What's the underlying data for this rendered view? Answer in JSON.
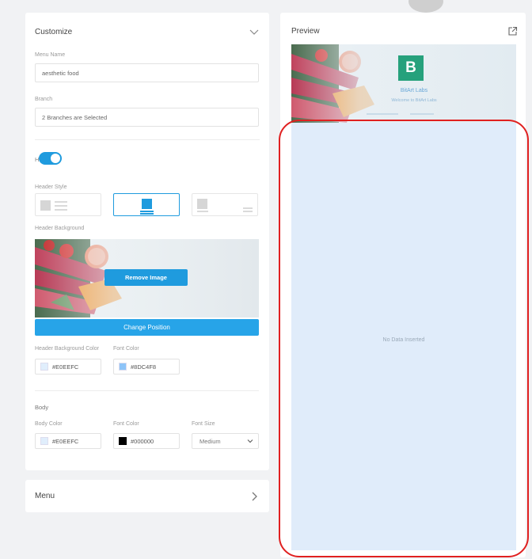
{
  "customize": {
    "title": "Customize",
    "menu_name_label": "Menu Name",
    "menu_name_value": "aesthetic food",
    "branch_label": "Branch",
    "branch_value": "2 Branches are Selected",
    "header_label": "Header",
    "header_enabled": true,
    "header_style_label": "Header Style",
    "header_background_label": "Header Background",
    "remove_image_label": "Remove Image",
    "change_position_label": "Change Position",
    "header_bg_color_label": "Header Background Color",
    "header_bg_color_value": "#E0EEFC",
    "header_font_color_label": "Font Color",
    "header_font_color_value": "#8DC4F8",
    "body_label": "Body",
    "body_color_label": "Body Color",
    "body_color_value": "#E0EEFC",
    "body_font_color_label": "Font Color",
    "body_font_color_value": "#000000",
    "font_size_label": "Font Size",
    "font_size_value": "Medium"
  },
  "menu_section": {
    "title": "Menu"
  },
  "preview": {
    "title": "Preview",
    "brand_letter": "B",
    "brand_name": "BitArt Labs",
    "welcome_text": "Welcome to BitArt Labs",
    "no_data_text": "No Data Inserted"
  },
  "colors": {
    "accent": "#1F9BDE",
    "header_bg": "#E0EEFC",
    "header_font": "#8DC4F8",
    "body_bg": "#E0EEFC",
    "body_font": "#000000",
    "annotation": "#E02020"
  }
}
